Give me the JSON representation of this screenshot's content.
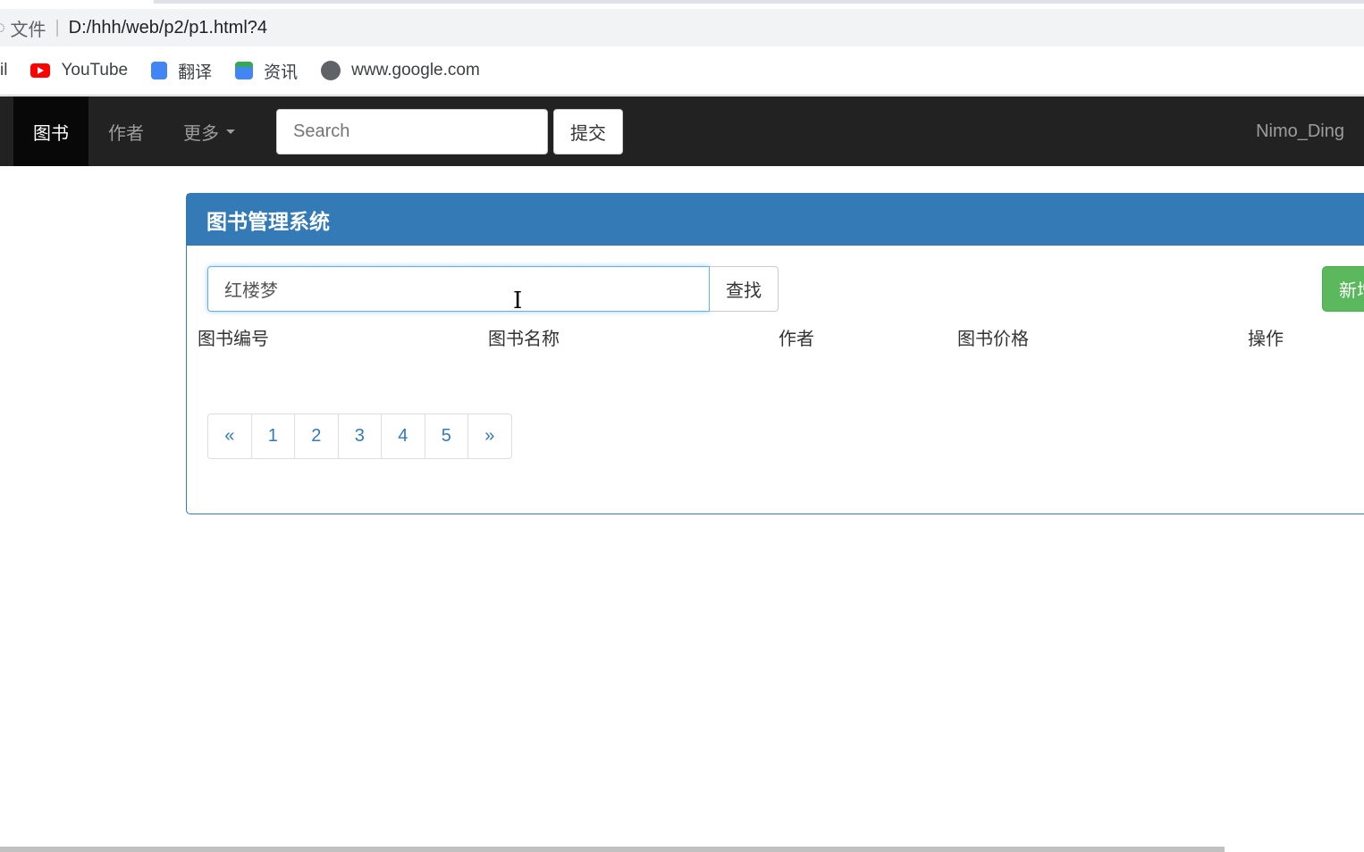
{
  "browser": {
    "security_label": "文件",
    "url": "D:/hhh/web/p2/p1.html?4",
    "bookmarks": [
      {
        "label": "il",
        "icon": "mail-icon"
      },
      {
        "label": "YouTube",
        "icon": "youtube-icon",
        "color": "#ff0000"
      },
      {
        "label": "翻译",
        "icon": "translate-icon",
        "color": "#4285f4"
      },
      {
        "label": "资讯",
        "icon": "news-icon",
        "color": "#4285f4"
      },
      {
        "label": "www.google.com",
        "icon": "globe-icon",
        "color": "#5f6368"
      }
    ]
  },
  "navbar": {
    "items": [
      {
        "label": "图书",
        "active": true
      },
      {
        "label": "作者"
      },
      {
        "label": "更多"
      }
    ],
    "search_placeholder": "Search",
    "submit_label": "提交",
    "user": "Nimo_Ding"
  },
  "panel": {
    "title": "图书管理系统",
    "search_value": "红楼梦",
    "search_button": "查找",
    "add_button": "新增",
    "columns": [
      "图书编号",
      "图书名称",
      "作者",
      "图书价格",
      "操作"
    ],
    "pagination": [
      "«",
      "1",
      "2",
      "3",
      "4",
      "5",
      "»"
    ]
  },
  "colors": {
    "primary": "#337ab7",
    "success": "#5cb85c",
    "navbar": "#222222"
  }
}
